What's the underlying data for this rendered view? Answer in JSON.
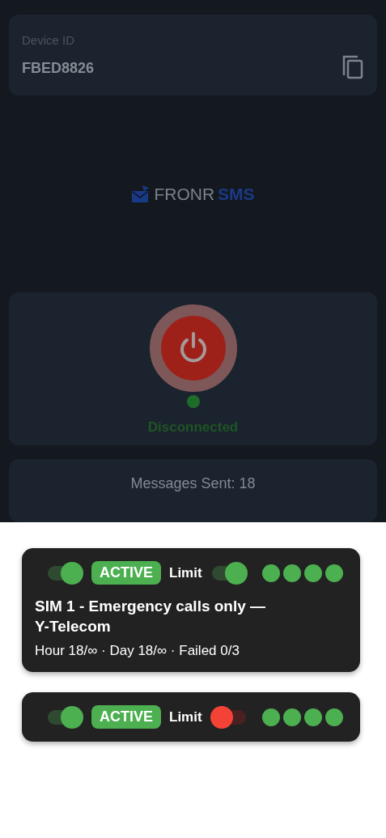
{
  "device": {
    "label": "Device ID",
    "value": "FBED8826"
  },
  "logo": {
    "word1": "FRONR",
    "word2": "SMS"
  },
  "connection": {
    "connected": false,
    "status": "Disconnected"
  },
  "stats": {
    "messages_sent": "Messages Sent: 18"
  },
  "sims": [
    {
      "enabled": true,
      "status": "ACTIVE",
      "limit_label": "Limit",
      "limit_on": true,
      "title": "SIM 1 - Emergency calls only —\nY-Telecom",
      "details": "Hour 18/∞ · Day 18/∞ · Failed 0/3",
      "indicators": [
        {
          "color": "#4caf50"
        },
        {
          "color": "#4caf50"
        },
        {
          "color": "#4caf50"
        },
        {
          "color": "#4caf50"
        }
      ]
    },
    {
      "enabled": true,
      "status": "ACTIVE",
      "limit_label": "Limit",
      "limit_on": false,
      "indicators": [
        {
          "color": "#4caf50"
        },
        {
          "color": "#4caf50"
        },
        {
          "color": "#4caf50"
        },
        {
          "color": "#4caf50"
        }
      ]
    }
  ]
}
